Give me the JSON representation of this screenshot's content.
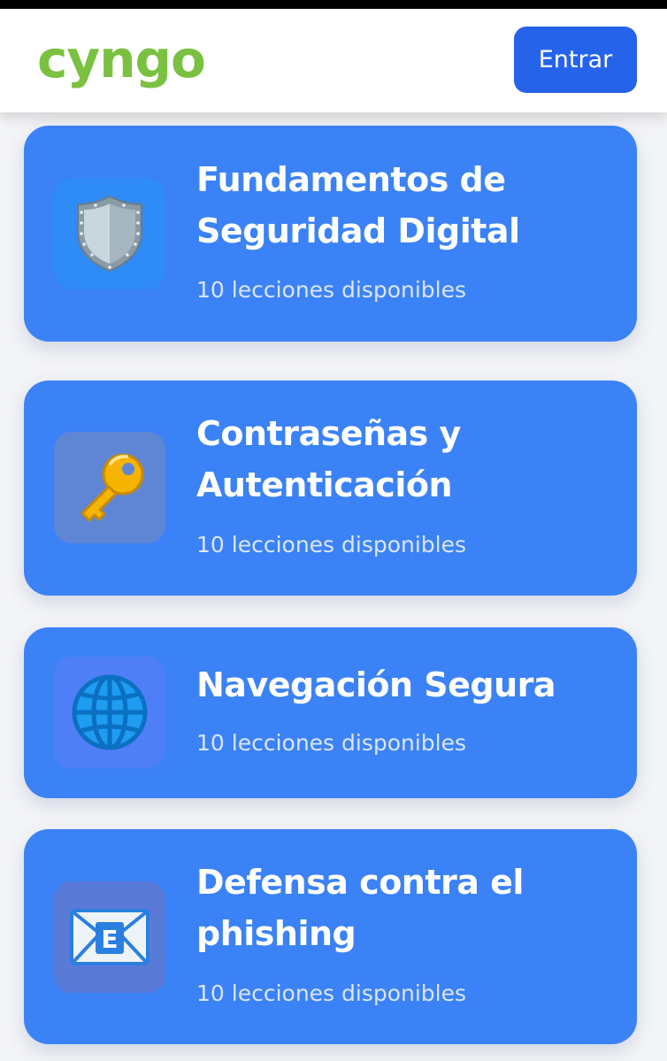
{
  "header": {
    "logo_text": "cyngo",
    "login_label": "Entrar"
  },
  "colors": {
    "logo": "#7ac142",
    "primary_button": "#2563eb",
    "card": "#3b82f6",
    "shield_box": "#2f8bf6",
    "key_box": "#5f86d5",
    "globe_box": "#4f7ff6",
    "mail_box": "#5a7ad8"
  },
  "courses": [
    {
      "title": "Fundamentos de Seguridad Digital",
      "lessons": "10 lecciones disponibles",
      "icon": "shield-icon"
    },
    {
      "title": "Contraseñas y Autenticación",
      "lessons": "10 lecciones disponibles",
      "icon": "key-icon"
    },
    {
      "title": "Navegación Segura",
      "lessons": "10 lecciones disponibles",
      "icon": "globe-icon"
    },
    {
      "title": "Defensa contra el phishing",
      "lessons": "10 lecciones disponibles",
      "icon": "envelope-icon"
    }
  ]
}
